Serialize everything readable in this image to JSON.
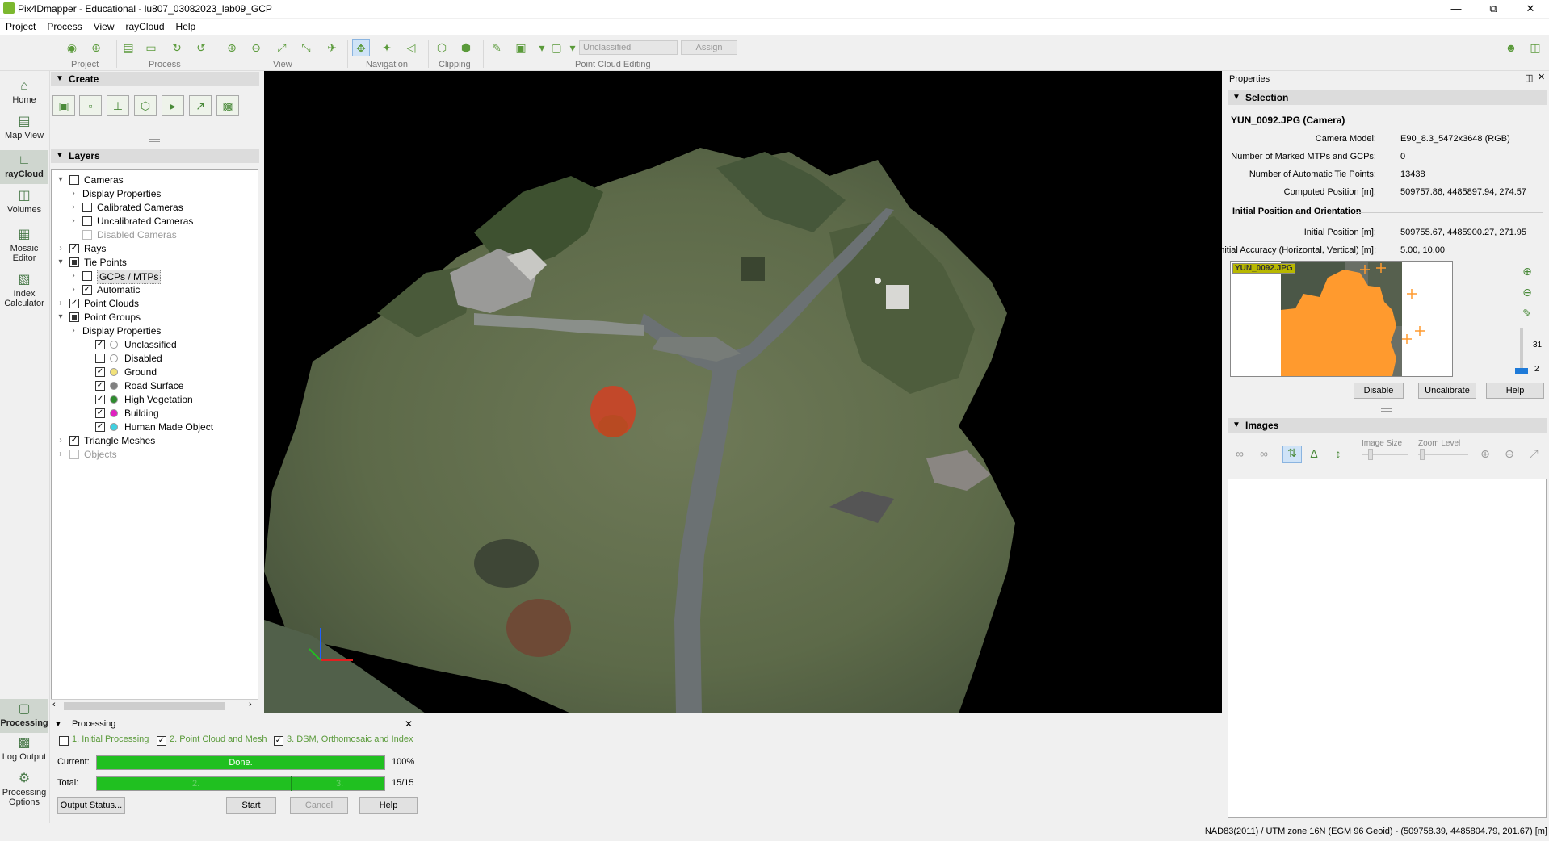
{
  "window": {
    "title": "Pix4Dmapper - Educational - lu807_03082023_lab09_GCP",
    "controls": [
      "—",
      "⧉",
      "✕"
    ]
  },
  "menu": [
    "Project",
    "Process",
    "View",
    "rayCloud",
    "Help"
  ],
  "toolbar": {
    "groups": [
      "Project",
      "Process",
      "View",
      "Navigation",
      "Clipping",
      "Point Cloud Editing"
    ],
    "classification_value": "Unclassified",
    "assign_label": "Assign"
  },
  "leftnav": [
    {
      "label": "Home",
      "icon": "home-icon"
    },
    {
      "label": "Map View",
      "icon": "map-icon"
    },
    {
      "label": "rayCloud",
      "icon": "raycloud-icon",
      "selected": true
    },
    {
      "label": "Volumes",
      "icon": "volumes-icon"
    },
    {
      "label": "Mosaic Editor",
      "icon": "mosaic-icon"
    },
    {
      "label": "Index Calculator",
      "icon": "index-calculator-icon"
    },
    {
      "label": "Processing",
      "icon": "processing-icon",
      "selected": true
    },
    {
      "label": "Log Output",
      "icon": "log-icon"
    },
    {
      "label": "Processing Options",
      "icon": "gear-icon"
    }
  ],
  "create": {
    "title": "Create"
  },
  "layers": {
    "title": "Layers",
    "rows": [
      {
        "label": "Cameras",
        "level": 0,
        "arrow": "▾",
        "checked": false
      },
      {
        "label": "Display Properties",
        "level": 1,
        "arrow": "›",
        "nocb": true
      },
      {
        "label": "Calibrated Cameras",
        "level": 1,
        "arrow": "›",
        "checked": false
      },
      {
        "label": "Uncalibrated Cameras",
        "level": 1,
        "arrow": "›",
        "checked": false
      },
      {
        "label": "Disabled Cameras",
        "level": 1,
        "arrow": "",
        "checked": false,
        "disabled": true
      },
      {
        "label": "Rays",
        "level": 0,
        "arrow": "›",
        "checked": true
      },
      {
        "label": "Tie Points",
        "level": 0,
        "arrow": "▾",
        "checked": "partial"
      },
      {
        "label": "GCPs / MTPs",
        "level": 1,
        "arrow": "›",
        "checked": false,
        "boxed": true
      },
      {
        "label": "Automatic",
        "level": 1,
        "arrow": "›",
        "checked": true
      },
      {
        "label": "Point Clouds",
        "level": 0,
        "arrow": "›",
        "checked": true
      },
      {
        "label": "Point Groups",
        "level": 0,
        "arrow": "▾",
        "checked": "partial"
      },
      {
        "label": "Display Properties",
        "level": 1,
        "arrow": "›",
        "nocb": true
      },
      {
        "label": "Unclassified",
        "level": 2,
        "checked": true,
        "dot": "#ffffff"
      },
      {
        "label": "Disabled",
        "level": 2,
        "checked": false,
        "dot": "#ffffff"
      },
      {
        "label": "Ground",
        "level": 2,
        "checked": true,
        "dot": "#f2e27a"
      },
      {
        "label": "Road Surface",
        "level": 2,
        "checked": true,
        "dot": "#808080"
      },
      {
        "label": "High Vegetation",
        "level": 2,
        "checked": true,
        "dot": "#2e8b2e"
      },
      {
        "label": "Building",
        "level": 2,
        "checked": true,
        "dot": "#e020c0"
      },
      {
        "label": "Human Made Object",
        "level": 2,
        "checked": true,
        "dot": "#40d0e0"
      },
      {
        "label": "Triangle Meshes",
        "level": 0,
        "arrow": "›",
        "checked": true
      },
      {
        "label": "Objects",
        "level": 0,
        "arrow": "›",
        "checked": false,
        "disabled": true
      }
    ]
  },
  "processing": {
    "title": "Processing",
    "steps": [
      {
        "label": "1. Initial Processing",
        "checked": false
      },
      {
        "label": "2. Point Cloud and Mesh",
        "checked": true
      },
      {
        "label": "3. DSM, Orthomosaic and Index",
        "checked": true
      }
    ],
    "current_label": "Current:",
    "current_bar_text": "Done.",
    "current_progress": 1.0,
    "current_value": "100%",
    "total_label": "Total:",
    "total_segments": [
      "2.",
      "3."
    ],
    "total_progress": 1.0,
    "total_value": "15/15",
    "buttons": {
      "output_status": "Output Status...",
      "start": "Start",
      "cancel": "Cancel",
      "help": "Help"
    }
  },
  "properties": {
    "title": "Properties",
    "selection_title": "Selection",
    "camera_name": "YUN_0092.JPG (Camera)",
    "fields": [
      {
        "key": "Camera Model:",
        "value": "E90_8.3_5472x3648 (RGB)"
      },
      {
        "key": "Number of Marked MTPs and GCPs:",
        "value": "0"
      },
      {
        "key": "Number of Automatic Tie Points:",
        "value": "13438"
      },
      {
        "key": "Computed Position [m]:",
        "value": "509757.86, 4485897.94, 274.57"
      }
    ],
    "initial_title": "Initial Position and Orientation",
    "initial_fields": [
      {
        "key": "Initial Position [m]:",
        "value": "509755.67, 4485900.27, 271.95"
      },
      {
        "key": "Initial Accuracy (Horizontal, Vertical) [m]:",
        "value": "5.00, 10.00"
      }
    ],
    "thumb_label": "YUN_0092.JPG",
    "zoom_max": "31",
    "zoom_min": "2",
    "buttons": {
      "disable": "Disable",
      "uncalibrate": "Uncalibrate",
      "help": "Help"
    },
    "images_title": "Images",
    "image_size_label": "Image Size",
    "zoom_level_label": "Zoom Level"
  },
  "status": {
    "coords": "NAD83(2011) / UTM zone 16N (EGM 96 Geoid) - (509758.39, 4485804.79, 201.67) [m]"
  },
  "colors": {
    "accent_green": "#7cb82f",
    "progress_green": "#20c020",
    "gcp_orange": "#ff9a2e"
  }
}
